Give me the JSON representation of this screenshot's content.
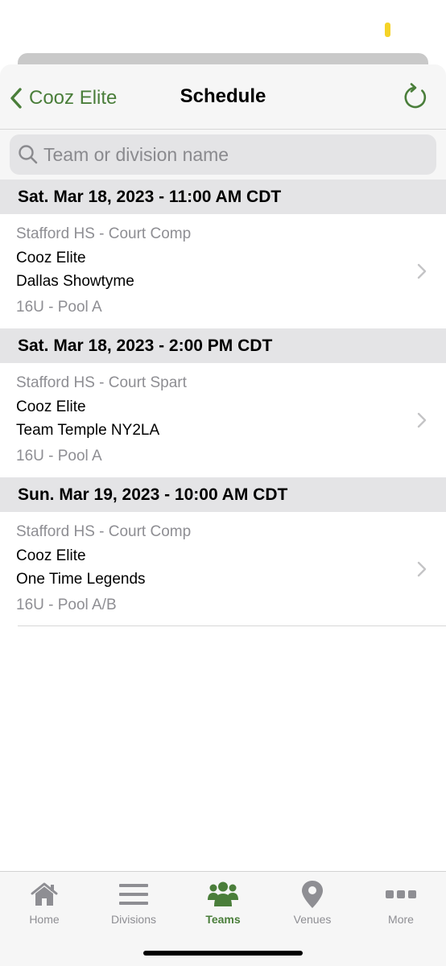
{
  "colors": {
    "accent": "#4a7e3a",
    "muted_text": "#8e8e93",
    "section_bg": "#e4e4e6",
    "nav_bg": "#f6f6f6"
  },
  "nav": {
    "back_label": "Cooz Elite",
    "title": "Schedule",
    "back_icon": "chevron-left-icon",
    "refresh_icon": "refresh-icon"
  },
  "search": {
    "placeholder": "Team or division name",
    "value": ""
  },
  "schedule": [
    {
      "header": "Sat. Mar 18, 2023 - 11:00 AM CDT",
      "venue": "Stafford HS - Court Comp",
      "team1": "Cooz Elite",
      "team2": "Dallas Showtyme",
      "division": "16U - Pool A"
    },
    {
      "header": "Sat. Mar 18, 2023 - 2:00 PM CDT",
      "venue": "Stafford HS - Court Spart",
      "team1": "Cooz Elite",
      "team2": "Team Temple NY2LA",
      "division": "16U - Pool A"
    },
    {
      "header": "Sun. Mar 19, 2023 - 10:00 AM CDT",
      "venue": "Stafford HS - Court Comp",
      "team1": "Cooz Elite",
      "team2": "One Time Legends",
      "division": "16U - Pool A/B"
    }
  ],
  "tabs": [
    {
      "label": "Home",
      "icon": "home-icon",
      "active": false
    },
    {
      "label": "Divisions",
      "icon": "list-icon",
      "active": false
    },
    {
      "label": "Teams",
      "icon": "people-icon",
      "active": true
    },
    {
      "label": "Venues",
      "icon": "map-pin-icon",
      "active": false
    },
    {
      "label": "More",
      "icon": "more-icon",
      "active": false
    }
  ]
}
